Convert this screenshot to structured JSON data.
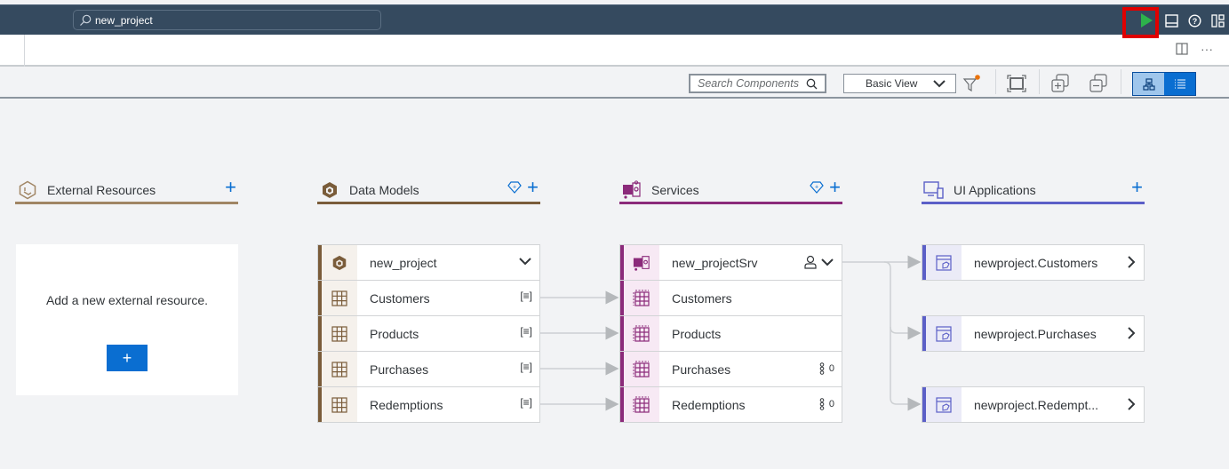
{
  "topbar": {
    "search_value": "new_project",
    "icons": [
      "run-icon",
      "panel-bottom-icon",
      "help-icon",
      "layout-icon"
    ]
  },
  "tabbar": {
    "icons": [
      "split-view-icon",
      "more-icon"
    ],
    "more_label": "···"
  },
  "toolbar": {
    "search_placeholder": "Search Components",
    "view_selected": "Basic View",
    "buttons": [
      "filter-icon",
      "fit-to-screen-icon",
      "expand-all-icon",
      "collapse-all-icon",
      "graph-view-icon",
      "list-view-icon"
    ]
  },
  "colors": {
    "topbar": "#354a5f",
    "external": "#a08564",
    "data_models": "#7a5c3a",
    "services": "#8b2a7a",
    "ui_apps": "#5b5fc7",
    "accent": "#0a6ed1",
    "run_green": "#2db24b",
    "highlight_red": "#e00000"
  },
  "columns": {
    "external": {
      "title": "External Resources",
      "empty_text": "Add a new external resource.",
      "add_label": "+"
    },
    "data_models": {
      "title": "Data Models",
      "header_item": "new_project",
      "items": [
        {
          "label": "Customers",
          "badge": "[≡]"
        },
        {
          "label": "Products",
          "badge": "[≡]"
        },
        {
          "label": "Purchases",
          "badge": "[≡]"
        },
        {
          "label": "Redemptions",
          "badge": "[≡]"
        }
      ]
    },
    "services": {
      "title": "Services",
      "header_item": "new_projectSrv",
      "items": [
        {
          "label": "Customers",
          "badge": ""
        },
        {
          "label": "Products",
          "badge": ""
        },
        {
          "label": "Purchases",
          "badge": "0"
        },
        {
          "label": "Redemptions",
          "badge": "0"
        }
      ]
    },
    "ui_apps": {
      "title": "UI Applications",
      "items": [
        {
          "label": "newproject.Customers"
        },
        {
          "label": "newproject.Purchases"
        },
        {
          "label": "newproject.Redempt..."
        }
      ]
    }
  }
}
